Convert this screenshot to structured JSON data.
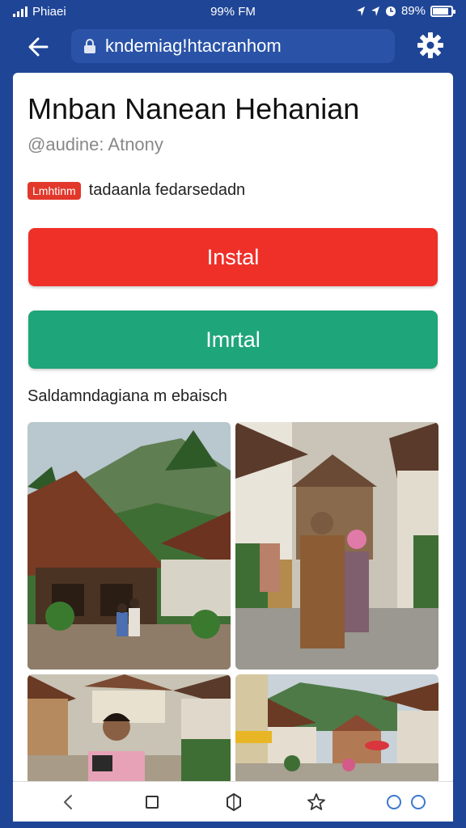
{
  "status": {
    "carrier": "Phiaei",
    "time": "99% FM",
    "battery": "89%",
    "battery_level": 0.85
  },
  "browser": {
    "url": "kndemiag!htacranhom"
  },
  "app": {
    "title": "Mnban Nanean Hehanian",
    "subtitle": "@audine: Atnony",
    "badge": "Lmhtinm",
    "badge_text": "tadaanla fedarsedadn",
    "primary_button": "Instal",
    "secondary_button": "Imrtal",
    "section_label": "Saldamndagiana m ebaisch"
  },
  "colors": {
    "header": "#1f4596",
    "install_red": "#ee3029",
    "install_green": "#1fa57a"
  },
  "gallery": [
    {
      "name": "village-house-mountain-photo"
    },
    {
      "name": "elder-woman-girl-photo"
    },
    {
      "name": "young-man-street-photo"
    },
    {
      "name": "village-market-stalls-photo"
    }
  ],
  "bottom_nav": [
    "back-icon",
    "tabs-icon",
    "home-icon",
    "bookmark-icon",
    "menu-icon"
  ]
}
